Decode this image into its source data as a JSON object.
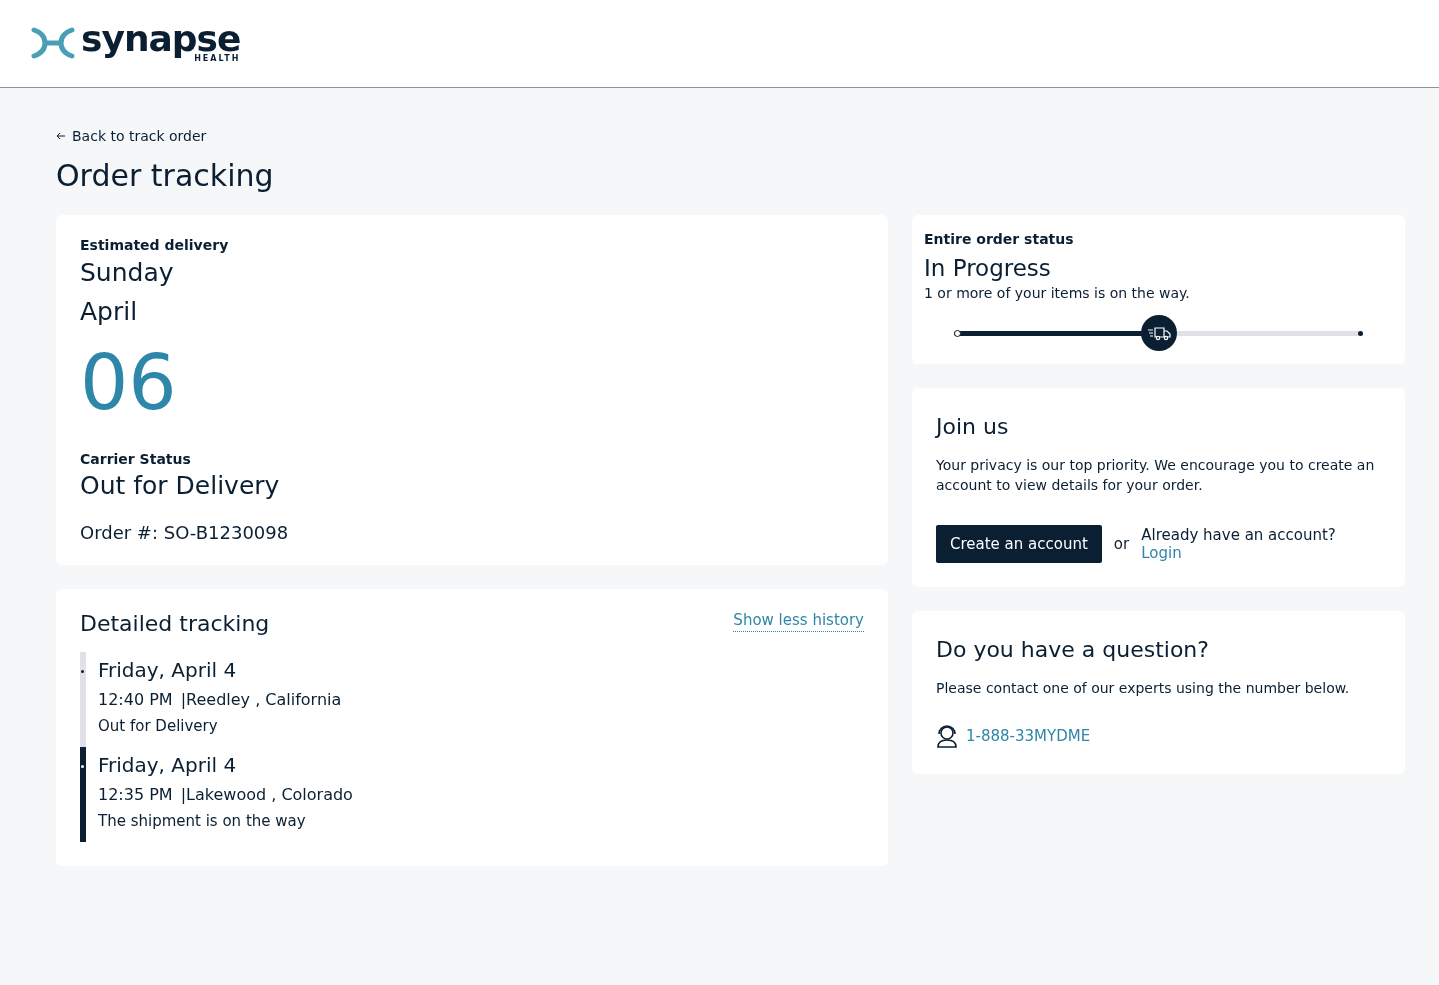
{
  "header": {
    "logo": {
      "word": "synapse",
      "sub": "HEALTH"
    }
  },
  "back_link": "Back to track order",
  "page_title": "Order tracking",
  "delivery": {
    "label": "Estimated delivery",
    "weekday": "Sunday",
    "month": "April",
    "day": "06",
    "carrier_label": "Carrier Status",
    "carrier_status": "Out for Delivery",
    "order_number": "Order #: SO-B1230098"
  },
  "tracking": {
    "title": "Detailed tracking",
    "toggle_link": "Show less history",
    "events": [
      {
        "date": "Friday, April 4",
        "time": "12:40 PM",
        "location": "|Reedley , California",
        "status": "Out for Delivery",
        "highlighted": false
      },
      {
        "date": "Friday, April 4",
        "time": "12:35 PM",
        "location": "|Lakewood , Colorado",
        "status": "The shipment is on the way",
        "highlighted": true
      }
    ]
  },
  "order_status": {
    "label": "Entire order status",
    "status": "In Progress",
    "note": "1 or more of your items is on the way.",
    "level": 0.5
  },
  "join": {
    "title": "Join us",
    "text": "Your privacy is our top priority. We encourage you to create an account to view details for your order.",
    "button": "Create an account",
    "or": "or",
    "prompt": "Already have an account?",
    "login": "Login"
  },
  "question": {
    "title": "Do you have a question?",
    "text": "Please contact one of our experts using the number below.",
    "phone": "1-888-33MYDME"
  }
}
